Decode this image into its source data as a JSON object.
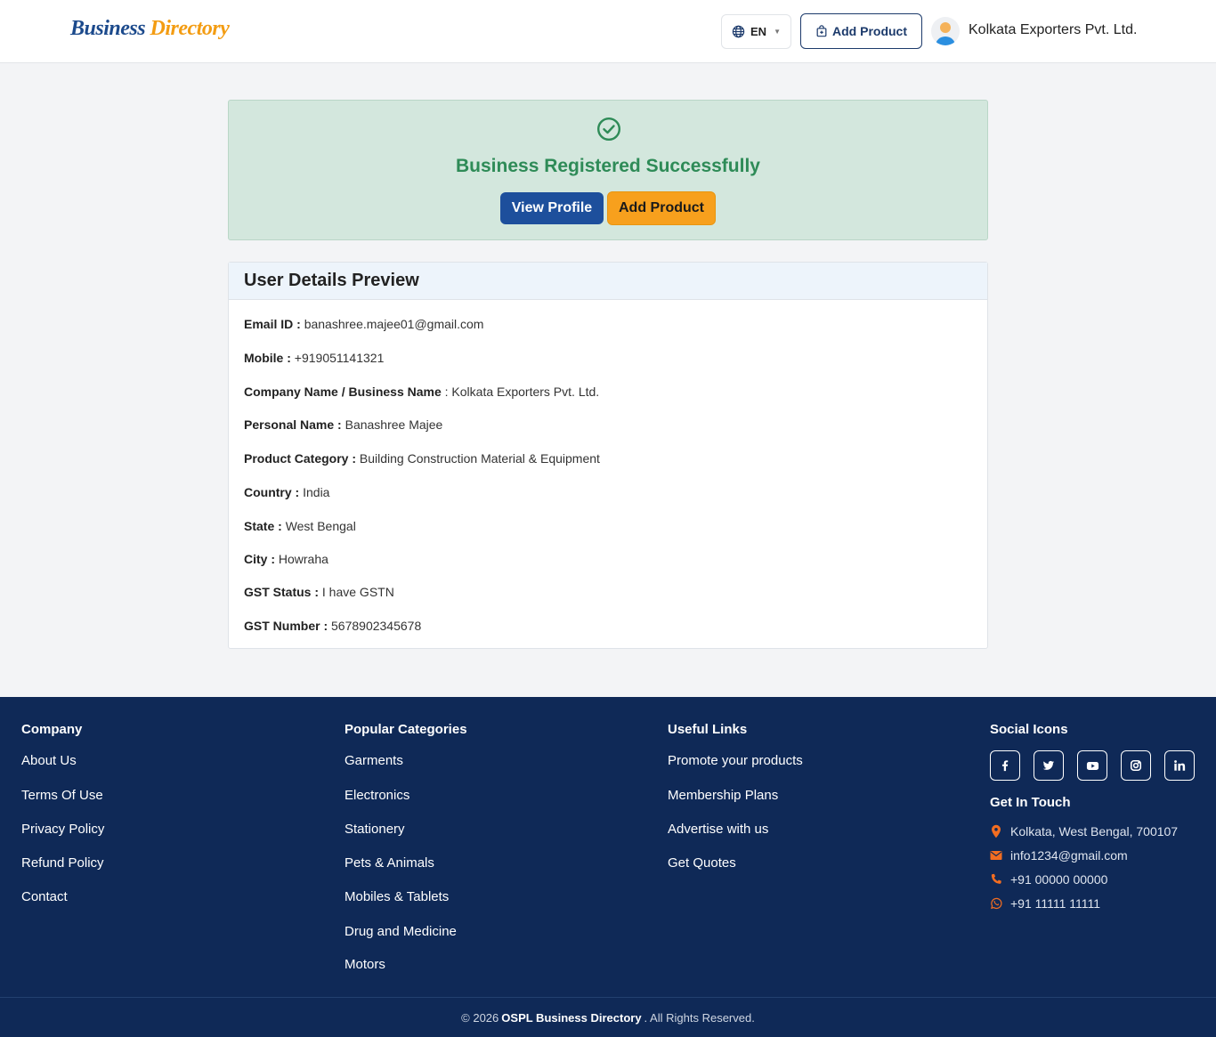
{
  "header": {
    "logo_part1": "Business",
    "logo_part2": "Directory",
    "language": "EN",
    "add_product_label": "Add Product",
    "user_name": "Kolkata Exporters Pvt. Ltd."
  },
  "success": {
    "message": "Business Registered Successfully",
    "view_profile_label": "View Profile",
    "add_product_label": "Add Product"
  },
  "details": {
    "title": "User Details Preview",
    "rows": [
      {
        "label": "Email ID :",
        "value": "banashree.majee01@gmail.com"
      },
      {
        "label": "Mobile :",
        "value": "+919051141321"
      },
      {
        "label": "Company Name / Business Name",
        "value": ": Kolkata Exporters Pvt. Ltd."
      },
      {
        "label": "Personal Name :",
        "value": "Banashree Majee"
      },
      {
        "label": "Product Category :",
        "value": "Building Construction Material & Equipment"
      },
      {
        "label": "Country :",
        "value": "India"
      },
      {
        "label": "State :",
        "value": "West Bengal"
      },
      {
        "label": "City :",
        "value": "Howraha"
      },
      {
        "label": "GST Status :",
        "value": "I have GSTN"
      },
      {
        "label": "GST Number :",
        "value": "5678902345678"
      }
    ]
  },
  "footer": {
    "company": {
      "title": "Company",
      "links": [
        "About Us",
        "Terms Of Use",
        "Privacy Policy",
        "Refund Policy",
        "Contact"
      ]
    },
    "categories": {
      "title": "Popular Categories",
      "links": [
        "Garments",
        "Electronics",
        "Stationery",
        "Pets & Animals",
        "Mobiles & Tablets",
        "Drug and Medicine",
        "Motors"
      ]
    },
    "useful": {
      "title": "Useful Links",
      "links": [
        "Promote your products",
        "Membership Plans",
        "Advertise with us",
        "Get Quotes"
      ]
    },
    "social": {
      "title": "Social Icons",
      "icons": [
        "facebook-icon",
        "twitter-icon",
        "youtube-icon",
        "instagram-icon",
        "linkedin-icon"
      ]
    },
    "contact": {
      "title": "Get In Touch",
      "address": "Kolkata, West Bengal, 700107",
      "email": "info1234@gmail.com",
      "phone": "+91 00000 00000",
      "whatsapp": "+91 11111 11111",
      "icon_color": "#f26d21"
    },
    "copyright_prefix": "© 2026",
    "copyright_brand": "OSPL Business Directory",
    "copyright_suffix": ". All Rights Reserved."
  }
}
